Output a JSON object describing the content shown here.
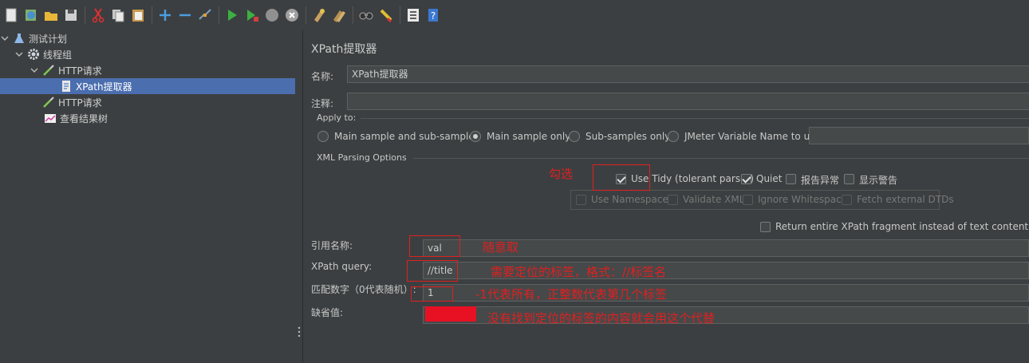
{
  "tree": {
    "items": [
      {
        "label": "测试计划"
      },
      {
        "label": "线程组"
      },
      {
        "label": "HTTP请求"
      },
      {
        "label": "XPath提取器"
      },
      {
        "label": "HTTP请求"
      },
      {
        "label": "查看结果树"
      }
    ]
  },
  "panel": {
    "title": "XPath提取器",
    "name_label": "名称:",
    "name_value": "XPath提取器",
    "comment_label": "注释:",
    "comment_value": "",
    "apply_to": {
      "label": "Apply to:",
      "options": [
        "Main sample and sub-samples",
        "Main sample only",
        "Sub-samples only",
        "JMeter Variable Name to use"
      ],
      "selected": "Main sample only",
      "var_name_value": ""
    },
    "xml_options": {
      "label": "XML Parsing Options",
      "use_tidy": {
        "label": "Use Tidy (tolerant parser)",
        "checked": true
      },
      "quiet": {
        "label": "Quiet",
        "checked": true
      },
      "report_errors": {
        "label": "报告异常",
        "checked": false
      },
      "show_warnings": {
        "label": "显示警告",
        "checked": false
      },
      "use_namespaces": {
        "label": "Use Namespaces",
        "checked": false
      },
      "validate_xml": {
        "label": "Validate XML",
        "checked": false
      },
      "ignore_whitespace": {
        "label": "Ignore Whitespace",
        "checked": false
      },
      "fetch_dtds": {
        "label": "Fetch external DTDs",
        "checked": false
      }
    },
    "return_fragment": {
      "label": "Return entire XPath fragment instead of text content?",
      "checked": false
    },
    "ref_name_label": "引用名称:",
    "ref_name_value": "val",
    "xpath_query_label": "XPath query:",
    "xpath_query_value": "//title",
    "match_no_label": "匹配数字（0代表随机）:",
    "match_no_value": "1",
    "default_label": "缺省值:",
    "default_value": ""
  },
  "annotations": {
    "check": "勾选",
    "ref_name": "随意取",
    "xpath": "需要定位的标签，格式：//标签名",
    "match": "-1代表所有，正整数代表第几个标签",
    "default": "没有找到定位的标签的内容就会用这个代替",
    "color": "#e02020"
  },
  "toolbar": {
    "icons": [
      "new-icon",
      "templates-icon",
      "open-icon",
      "save-icon",
      "cut-icon",
      "copy-icon",
      "paste-icon",
      "expand-icon",
      "collapse-icon",
      "toggle-icon",
      "start-icon",
      "start-no-pause-icon",
      "stop-icon",
      "shutdown-icon",
      "clear-icon",
      "clear-all-icon",
      "search-icon",
      "reset-search-icon",
      "function-helper-icon",
      "help-icon"
    ]
  }
}
